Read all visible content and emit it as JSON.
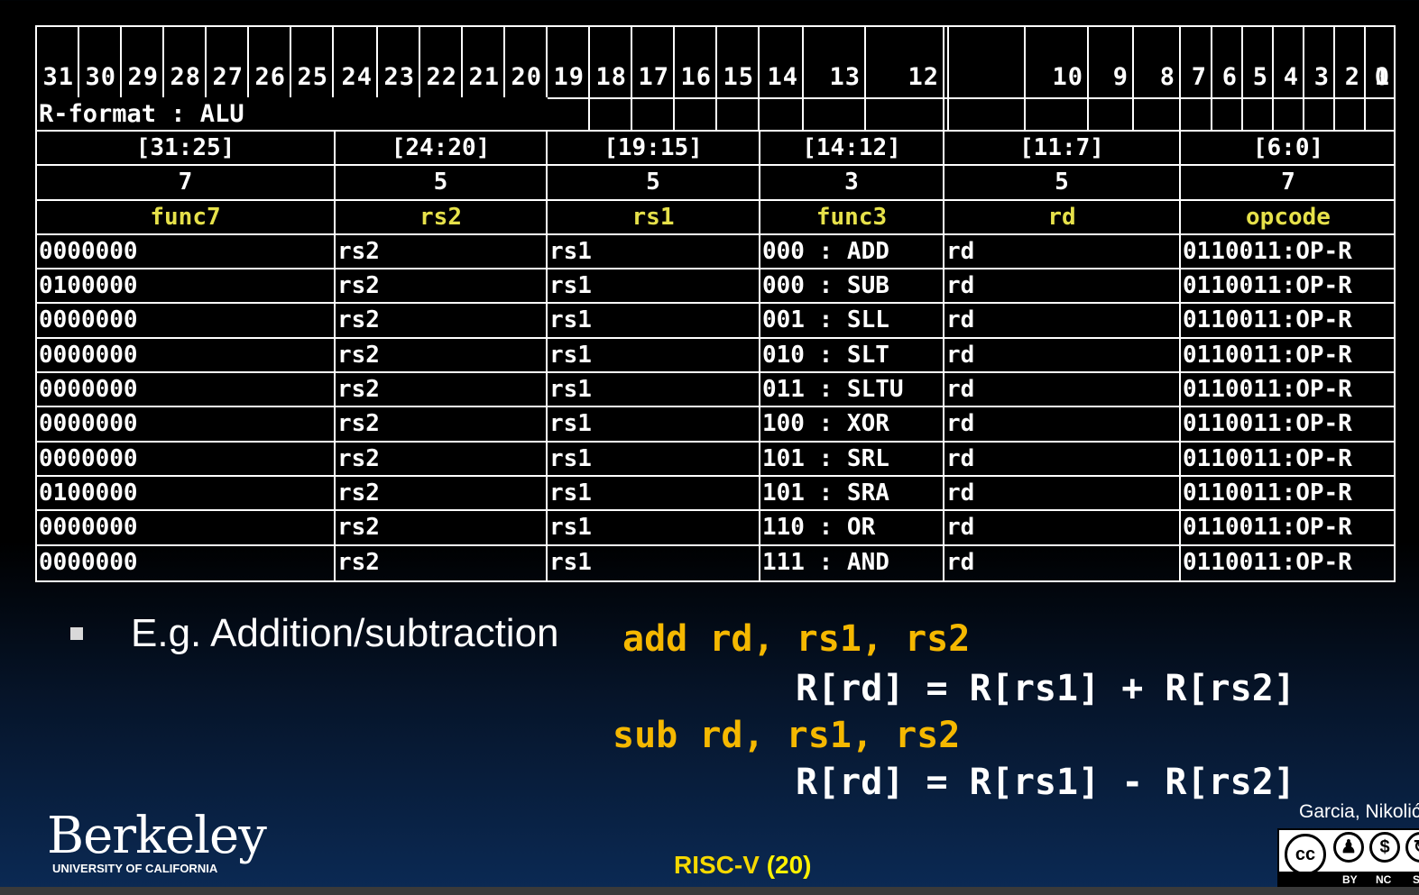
{
  "bit_numbers": [
    "31",
    "30",
    "29",
    "28",
    "27",
    "26",
    "25",
    "24",
    "23",
    "22",
    "21",
    "20",
    "19",
    "18",
    "17",
    "16",
    "15",
    "14",
    "13",
    "12",
    "",
    "10",
    "9",
    "8",
    "7",
    "6",
    "5",
    "4",
    "3",
    "2",
    "1",
    "0"
  ],
  "format_label": "R-format : ALU",
  "field_ranges": [
    "[31:25]",
    "[24:20]",
    "[19:15]",
    "[14:12]",
    "[11:7]",
    "[6:0]"
  ],
  "field_widths": [
    "7",
    "5",
    "5",
    "3",
    "5",
    "7"
  ],
  "field_names": [
    "func7",
    "rs2",
    "rs1",
    "func3",
    "rd",
    "opcode"
  ],
  "rows": [
    [
      "0000000",
      "rs2",
      "rs1",
      "000 : ADD",
      "rd",
      "0110011:OP-R"
    ],
    [
      "0100000",
      "rs2",
      "rs1",
      "000 : SUB",
      "rd",
      "0110011:OP-R"
    ],
    [
      "0000000",
      "rs2",
      "rs1",
      "001 : SLL",
      "rd",
      "0110011:OP-R"
    ],
    [
      "0000000",
      "rs2",
      "rs1",
      "010 : SLT",
      "rd",
      "0110011:OP-R"
    ],
    [
      "0000000",
      "rs2",
      "rs1",
      "011 : SLTU",
      "rd",
      "0110011:OP-R"
    ],
    [
      "0000000",
      "rs2",
      "rs1",
      "100 : XOR",
      "rd",
      "0110011:OP-R"
    ],
    [
      "0000000",
      "rs2",
      "rs1",
      "101 : SRL",
      "rd",
      "0110011:OP-R"
    ],
    [
      "0100000",
      "rs2",
      "rs1",
      "101 : SRA",
      "rd",
      "0110011:OP-R"
    ],
    [
      "0000000",
      "rs2",
      "rs1",
      "110 : OR",
      "rd",
      "0110011:OP-R"
    ],
    [
      "0000000",
      "rs2",
      "rs1",
      "111 : AND",
      "rd",
      "0110011:OP-R"
    ]
  ],
  "example": {
    "label": "E.g. Addition/subtraction",
    "add_instr": "add rd, rs1, rs2",
    "add_expr": "R[rd] = R[rs1] + R[rs2]",
    "sub_instr": "sub rd, rs1, rs2",
    "sub_expr": "R[rd] = R[rs1] - R[rs2]"
  },
  "footer": {
    "logo_text": "Berkeley",
    "logo_subtext": "UNIVERSITY OF CALIFORNIA",
    "slide_title": "RISC-V",
    "slide_number": "(20)",
    "author": "Garcia, Nikolić",
    "license_labels": [
      "BY",
      "NC",
      "SA"
    ]
  },
  "colors": {
    "field_name": "#e6e14a",
    "code_accent": "#f5b800",
    "footer_accent": "#f5d800"
  }
}
